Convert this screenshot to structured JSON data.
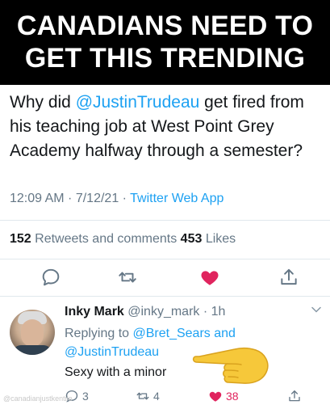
{
  "banner": {
    "line1": "CANADIANS NEED TO",
    "line2": "GET THIS TRENDING"
  },
  "tweet": {
    "text_pre": "Why did ",
    "mention": "@JustinTrudeau",
    "text_post": " get fired from his teaching job at West Point Grey Academy halfway through a semester?",
    "time": "12:09 AM",
    "separator": " · ",
    "date": "7/12/21",
    "separator2": " · ",
    "source": "Twitter Web App",
    "retweets_count": "152",
    "retweets_label": " Retweets and comments ",
    "likes_count": "453",
    "likes_label": " Likes",
    "icons": [
      "reply-icon",
      "retweet-icon",
      "heart-icon",
      "share-icon"
    ],
    "liked_color": "#e0245e",
    "accent_color": "#1da1f2"
  },
  "reply": {
    "name": "Inky Mark",
    "handle": " @inky_mark",
    "time": " · 1h",
    "replying_prefix": "Replying to ",
    "replying_to_1": "@Bret_Sears and",
    "replying_to_2": "@JustinTrudeau",
    "text": "Sexy with a minor",
    "reply_count": "3",
    "retweet_count": "4",
    "like_count": "38"
  },
  "watermark": "@canadianjustkentile"
}
